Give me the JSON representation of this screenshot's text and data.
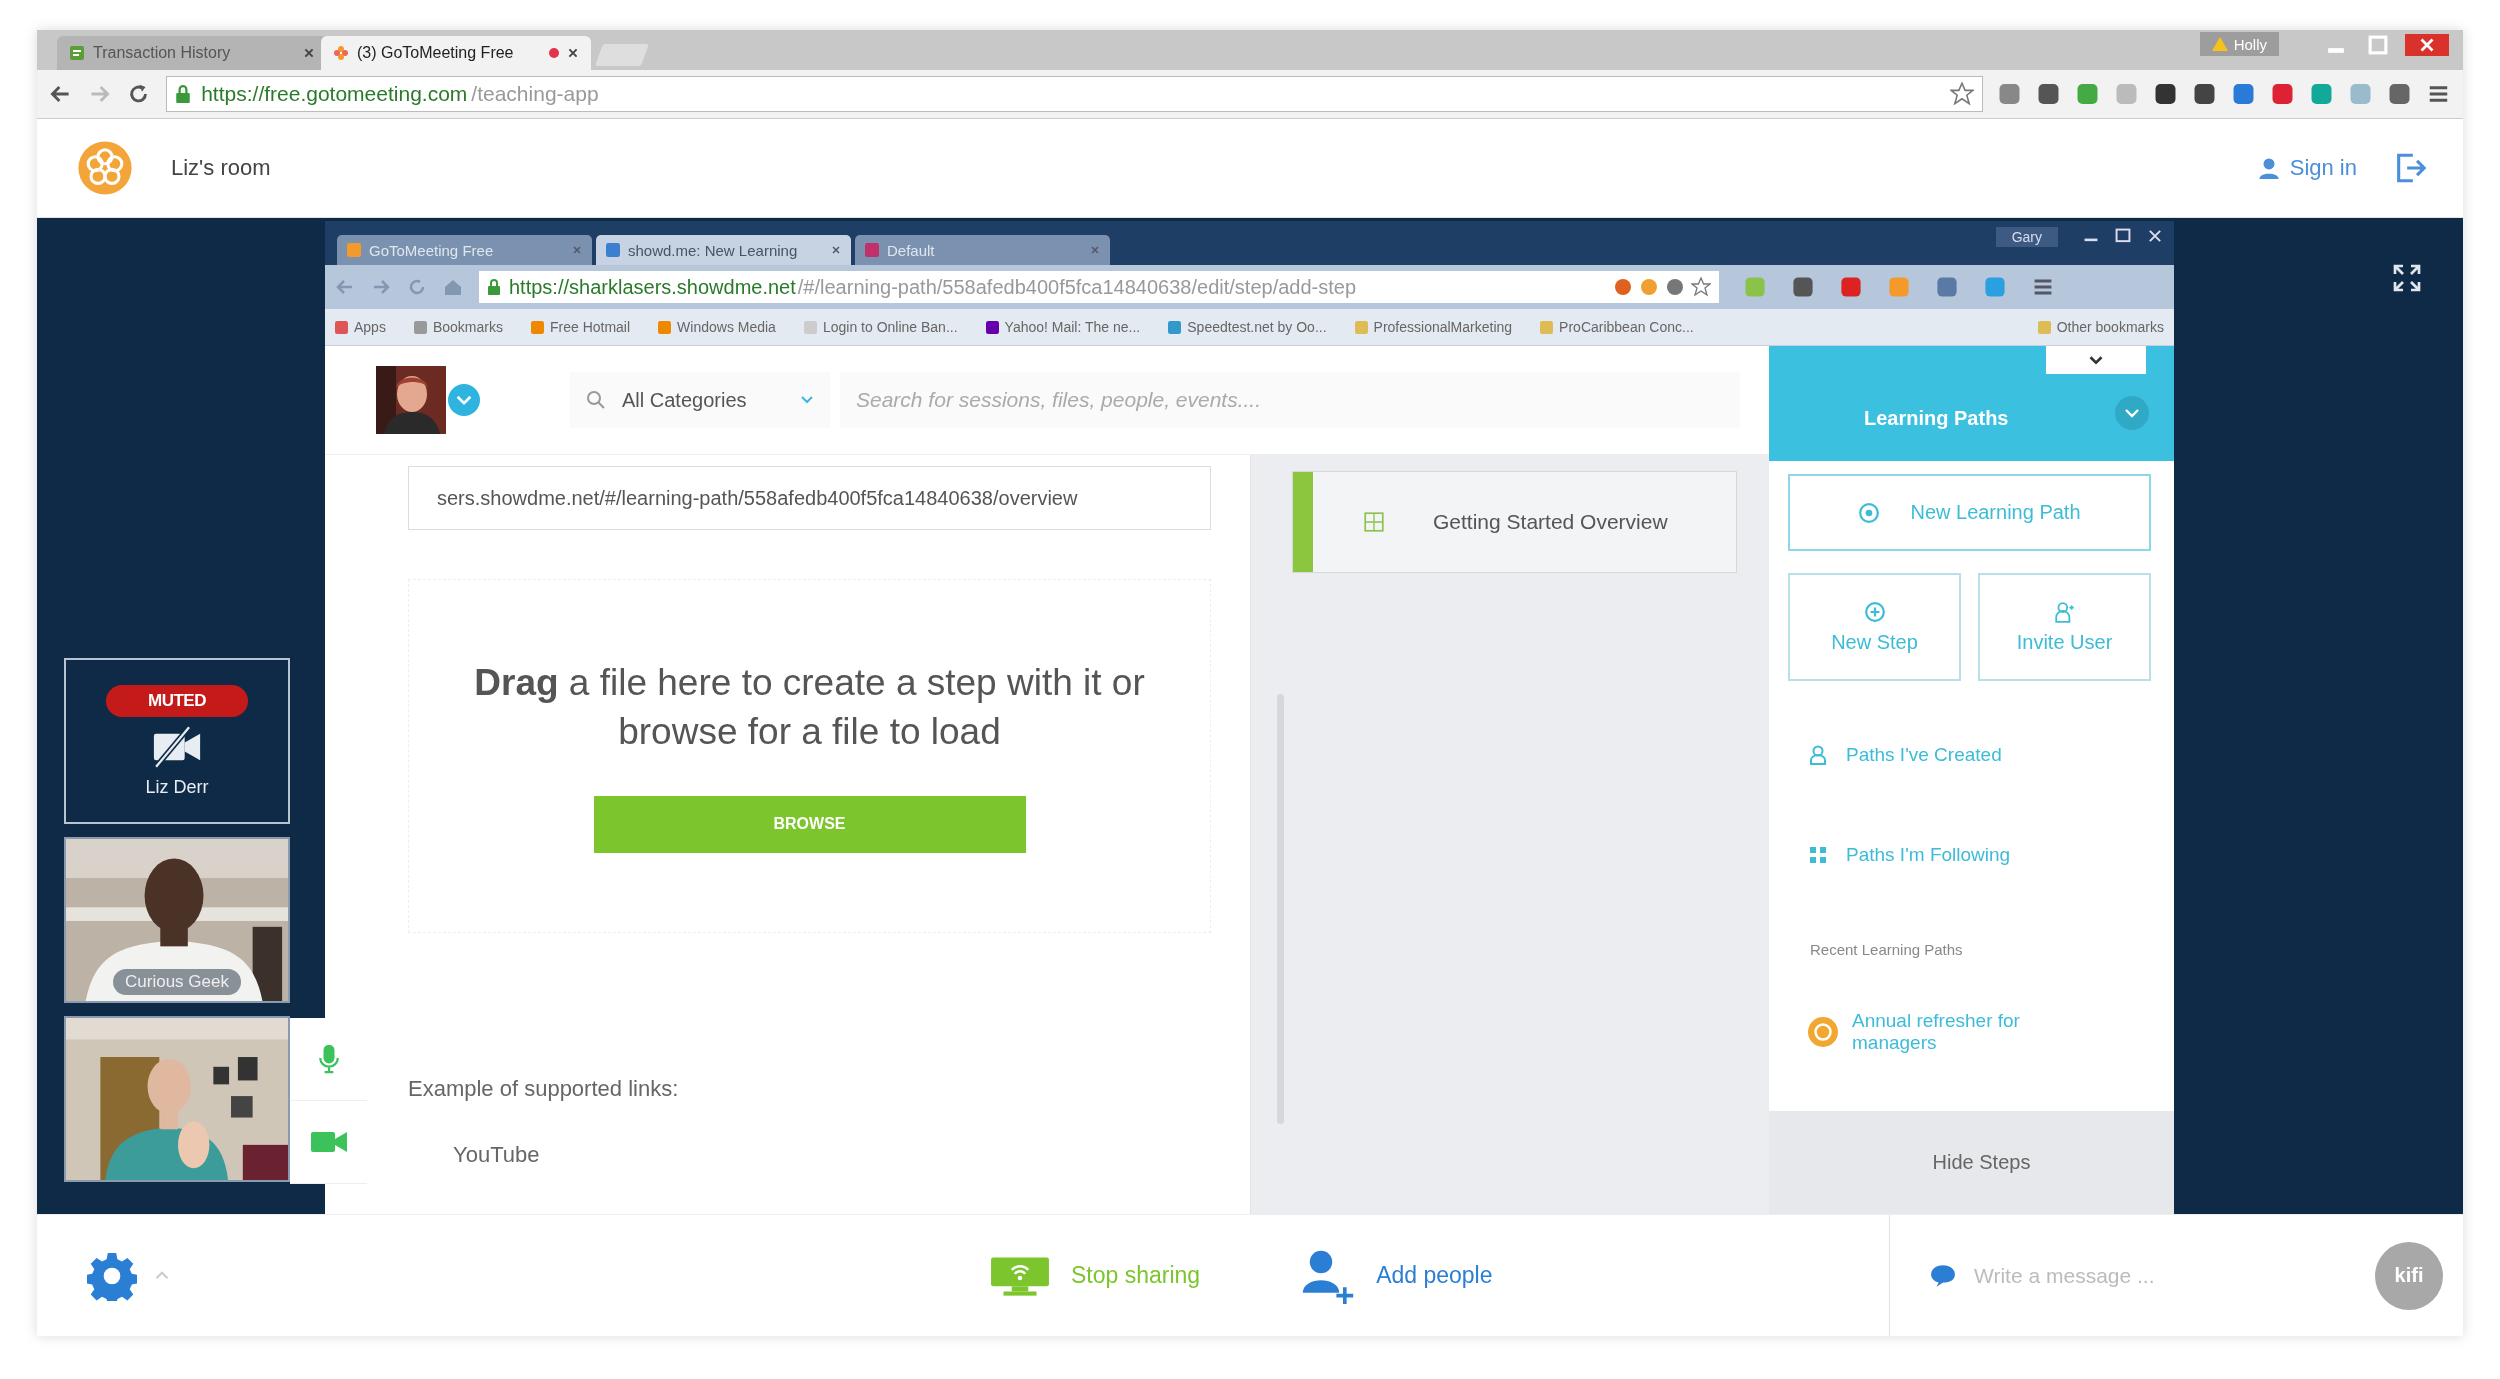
{
  "browser": {
    "tabs": [
      {
        "title": "Transaction History",
        "selected": false
      },
      {
        "title": "(3) GoToMeeting Free",
        "selected": true
      }
    ],
    "profile": "Holly",
    "url": {
      "host": "https://free.gotomeeting.com",
      "path": "/teaching-app"
    }
  },
  "header": {
    "room": "Liz's room",
    "sign_in": "Sign in"
  },
  "participants": [
    {
      "kind": "muted",
      "badge": "MUTED",
      "name": "Liz Derr"
    },
    {
      "kind": "video",
      "name": "Curious Geek"
    },
    {
      "kind": "video"
    }
  ],
  "media": {
    "mic_on": true,
    "camera_on": true
  },
  "shared": {
    "tabs": [
      {
        "title": "GoToMeeting Free",
        "selected": false
      },
      {
        "title": "showd.me: New Learning",
        "selected": true
      },
      {
        "title": "Default",
        "selected": false
      }
    ],
    "profile": "Gary",
    "url": {
      "host": "https://sharklasers.showdme.net",
      "path": "/#/learning-path/558afedb400f5fca14840638/edit/step/add-step"
    },
    "bookmarks": [
      "Apps",
      "Bookmarks",
      "Free Hotmail",
      "Windows Media",
      "Login to Online Ban...",
      "Yahoo! Mail: The ne...",
      "Speedtest.net by Oo...",
      "ProfessionalMarketing",
      "ProCaribbean Conc...",
      "Other bookmarks"
    ],
    "page": {
      "category": "All Categories",
      "search_placeholder": "Search for sessions, files, people, events....",
      "link_value": "sers.showdme.net/#/learning-path/558afedb400f5fca14840638/overview",
      "drop_text": "**Drag** a file here to create a step with it or browse for a file to load",
      "browse": "BROWSE",
      "examples_label": "Example of supported links:",
      "examples": [
        "YouTube"
      ],
      "steps": [
        {
          "title": "Getting Started Overview",
          "selected": true
        }
      ],
      "panel": {
        "title": "Learning Paths",
        "new_path": "New Learning Path",
        "actions": [
          {
            "kind": "add",
            "label": "New Step"
          },
          {
            "kind": "invite",
            "label": "Invite User"
          }
        ],
        "links": [
          {
            "kind": "created",
            "label": "Paths I've Created"
          },
          {
            "kind": "following",
            "label": "Paths I'm Following"
          }
        ],
        "recent_heading": "Recent Learning Paths",
        "recent": [
          "Annual refresher for managers"
        ],
        "hide_steps": "Hide Steps"
      }
    }
  },
  "toolbar": {
    "stop_sharing": "Stop sharing",
    "add_people": "Add people",
    "message_placeholder": "Write a message ...",
    "avatar": "kifi"
  }
}
